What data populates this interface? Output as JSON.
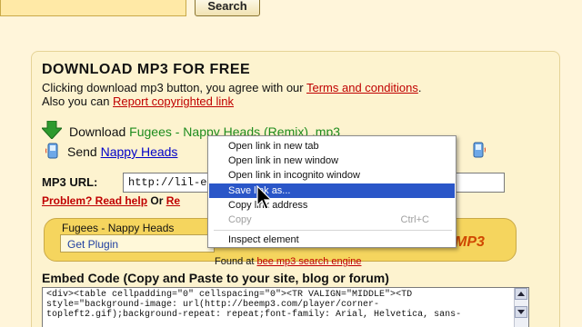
{
  "top": {
    "search_label": "Search"
  },
  "main": {
    "title": "DOWNLOAD MP3 FOR FREE",
    "para1_text": "Clicking download mp3 button, you agree with our ",
    "terms_link": "Terms and conditions",
    "para1_end": ".",
    "para2_text": "Also you can ",
    "report_link": "Report copyrighted link",
    "download_prefix": "Download ",
    "download_song": "Fugees - Nappy Heads (Remix) .mp3",
    "send_prefix": "Send ",
    "send_link": "Nappy Heads",
    "mp3url_label": "MP3 URL:",
    "mp3url_value": "http://lil-e.net,",
    "help_link": "Problem? Read help",
    "or_text": " Or ",
    "re_link": "Re"
  },
  "player": {
    "title": "Fugees - Nappy Heads",
    "get_plugin": "Get Plugin",
    "logo": "MP3",
    "found_prefix": "Found at ",
    "found_link": "bee mp3 search engine"
  },
  "embed": {
    "label": "Embed Code (Copy and Paste to your site, blog or forum)",
    "code": "<div><table cellpadding=\"0\" cellspacing=\"0\"><TR VALIGN=\"MIDDLE\"><TD\nstyle=\"background-image: url(http://beemp3.com/player/corner-\ntopleft2.gif);background-repeat: repeat;font-family: Arial, Helvetica, sans-"
  },
  "context_menu": {
    "items": [
      {
        "label": "Open link in new tab"
      },
      {
        "label": "Open link in new window"
      },
      {
        "label": "Open link in incognito window"
      },
      {
        "label": "Save link as..."
      },
      {
        "label": "Copy link address"
      },
      {
        "label": "Copy",
        "shortcut": "Ctrl+C"
      },
      {
        "label": "Inspect element"
      }
    ]
  },
  "colors": {
    "background": "#fff5da",
    "link_red": "#c00000",
    "link_blue": "#0000c8",
    "song_green": "#1e8c1e",
    "menu_highlight": "#2a56c8",
    "player_yellow": "#f5d55e"
  },
  "icons": [
    "down-arrow-icon",
    "phone-icon",
    "mouse-cursor-icon",
    "scroll-up-icon",
    "scroll-down-icon"
  ]
}
